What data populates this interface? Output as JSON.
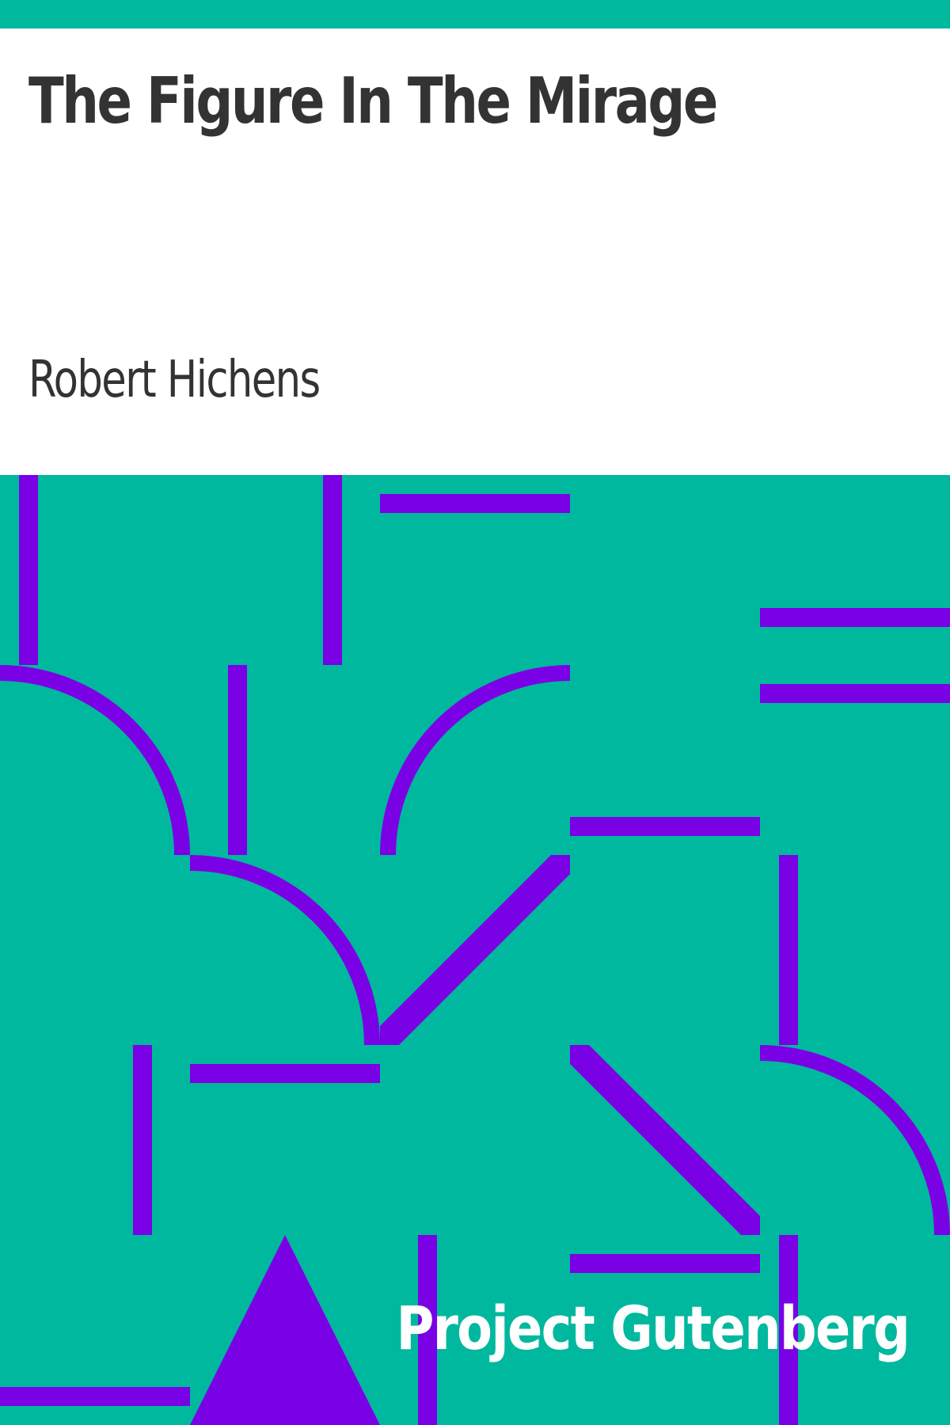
{
  "cover": {
    "title": "The Figure In The Mirage",
    "author": "Robert Hichens",
    "publisher": "Project Gutenberg"
  },
  "colors": {
    "background": "#00b89e",
    "panel": "#ffffff",
    "text": "#333333",
    "pattern": "#7a00e6",
    "publisher_text": "#ffffff"
  }
}
